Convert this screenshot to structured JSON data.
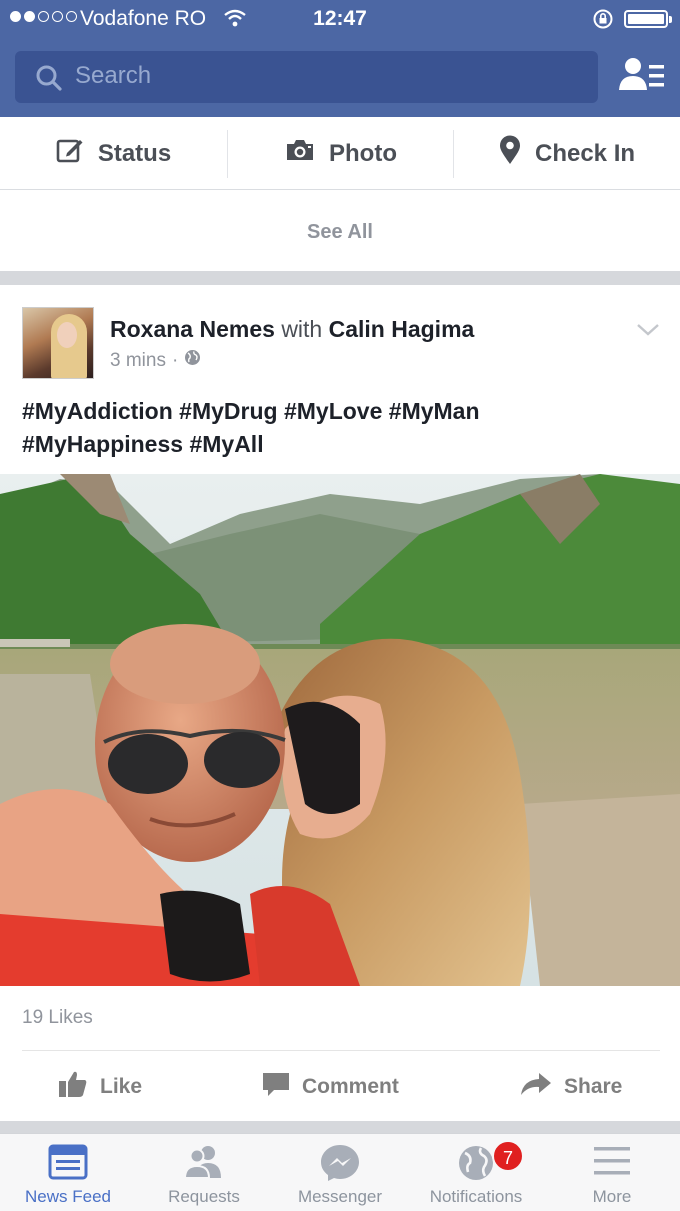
{
  "status_bar": {
    "signal_dots": 5,
    "signal_filled": 2,
    "carrier": "Vodafone RO",
    "time": "12:47"
  },
  "search": {
    "placeholder": "Search"
  },
  "publisher": {
    "status_label": "Status",
    "photo_label": "Photo",
    "checkin_label": "Check In",
    "see_all_label": "See All"
  },
  "post": {
    "author": "Roxana Nemes",
    "with_word": "with",
    "tagged": "Calin Hagima",
    "time": "3 mins",
    "privacy_separator": "·",
    "text_line1": "#MyAddiction #MyDrug #MyLove #MyMan",
    "text_line2": "#MyHappiness #MyAll",
    "likes": "19 Likes",
    "actions": {
      "like": "Like",
      "comment": "Comment",
      "share": "Share"
    }
  },
  "tabs": [
    {
      "label": "News Feed",
      "icon": "news-feed-icon",
      "active": true
    },
    {
      "label": "Requests",
      "icon": "friend-requests-icon",
      "active": false
    },
    {
      "label": "Messenger",
      "icon": "messenger-icon",
      "active": false
    },
    {
      "label": "Notifications",
      "icon": "globe-icon",
      "active": false,
      "badge": "7"
    },
    {
      "label": "More",
      "icon": "hamburger-menu-icon",
      "active": false
    }
  ],
  "colors": {
    "header_blue": "#4c67a4",
    "search_field": "#3a5392",
    "active_tab": "#4a70c6",
    "badge_red": "#e02020"
  }
}
